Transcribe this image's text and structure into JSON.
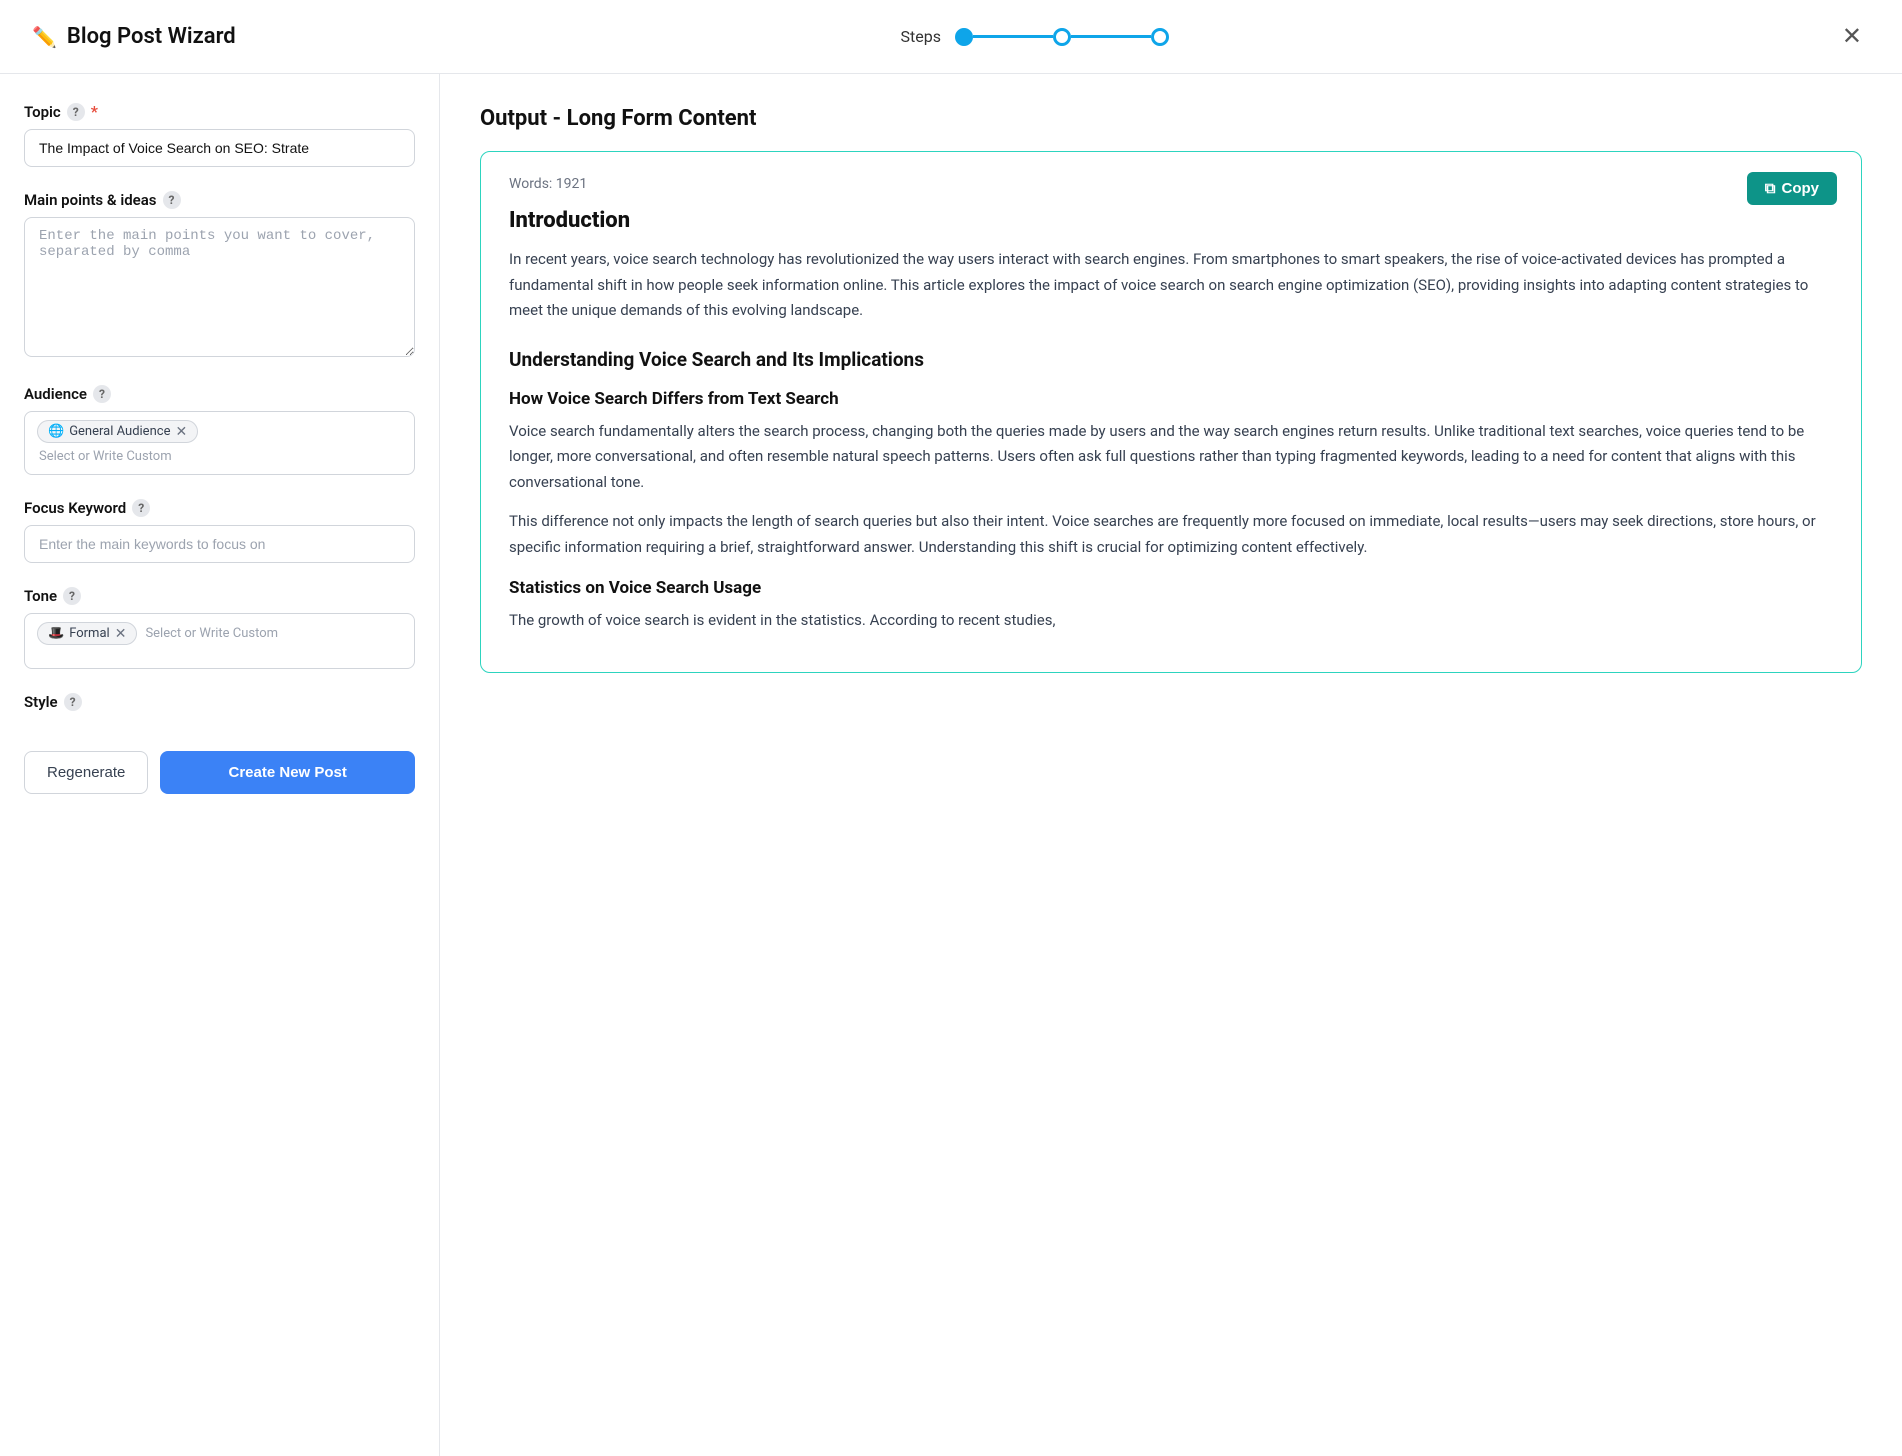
{
  "header": {
    "title": "Blog Post Wizard",
    "steps_label": "Steps",
    "close_label": "✕"
  },
  "steps": [
    {
      "state": "completed"
    },
    {
      "state": "active"
    },
    {
      "state": "active_end"
    }
  ],
  "left_panel": {
    "topic_label": "Topic",
    "topic_value": "The Impact of Voice Search on SEO: Strate",
    "main_points_label": "Main points & ideas",
    "main_points_placeholder": "Enter the main points you want to cover, separated by comma",
    "audience_label": "Audience",
    "audience_tag_emoji": "🌐",
    "audience_tag_text": "General Audience",
    "audience_placeholder": "Select or Write Custom",
    "focus_keyword_label": "Focus Keyword",
    "focus_keyword_placeholder": "Enter the main keywords to focus on",
    "tone_label": "Tone",
    "tone_tag_emoji": "🎩",
    "tone_tag_text": "Formal",
    "tone_placeholder": "Select or Write Custom",
    "style_label": "Style",
    "btn_regenerate": "Regenerate",
    "btn_create": "Create New Post"
  },
  "right_panel": {
    "output_title": "Output - Long Form Content",
    "words_label": "Words: 1921",
    "copy_btn_label": "Copy",
    "content": {
      "h1": "Introduction",
      "intro_p": "In recent years, voice search technology has revolutionized the way users interact with search engines. From smartphones to smart speakers, the rise of voice-activated devices has prompted a fundamental shift in how people seek information online. This article explores the impact of voice search on search engine optimization (SEO), providing insights into adapting content strategies to meet the unique demands of this evolving landscape.",
      "h2_1": "Understanding Voice Search and Its Implications",
      "h3_1": "How Voice Search Differs from Text Search",
      "p1": "Voice search fundamentally alters the search process, changing both the queries made by users and the way search engines return results. Unlike traditional text searches, voice queries tend to be longer, more conversational, and often resemble natural speech patterns. Users often ask full questions rather than typing fragmented keywords, leading to a need for content that aligns with this conversational tone.",
      "p2": "This difference not only impacts the length of search queries but also their intent. Voice searches are frequently more focused on immediate, local results—users may seek directions, store hours, or specific information requiring a brief, straightforward answer. Understanding this shift is crucial for optimizing content effectively.",
      "h3_2": "Statistics on Voice Search Usage",
      "p3": "The growth of voice search is evident in the statistics. According to recent studies,"
    }
  }
}
